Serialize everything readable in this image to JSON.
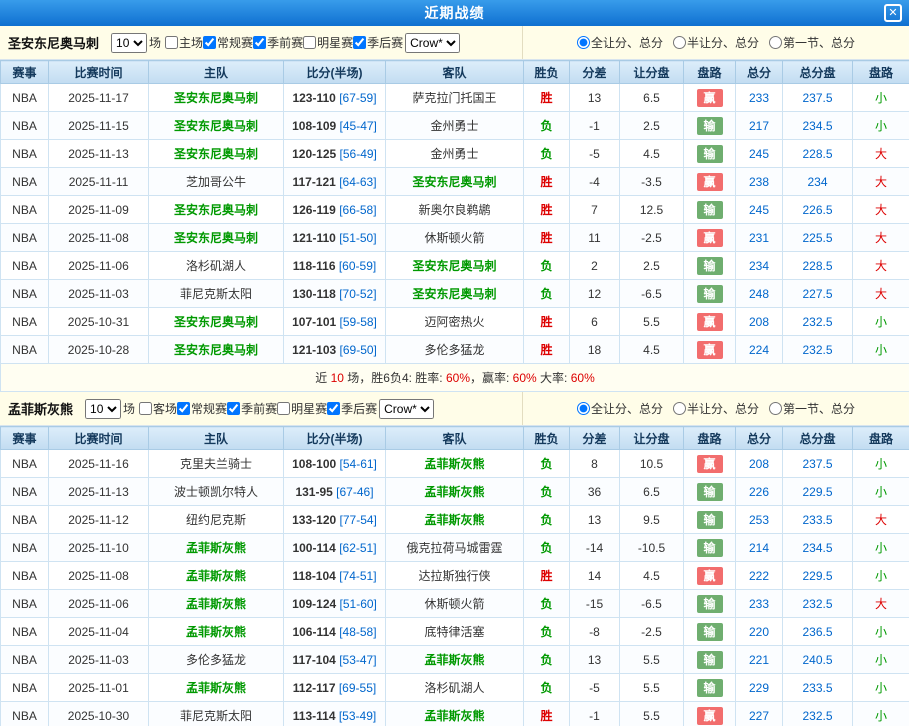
{
  "header": {
    "title": "近期战绩",
    "close_icon": "✕"
  },
  "colors": {
    "titlebar_blue": "#1e7fd6",
    "filter_bg": "#fffde8",
    "table_header_bg": "#cde3f4",
    "focus_team_green": "#009900",
    "win_red": "#dd0000",
    "lose_green": "#009900",
    "handicap_win_bg": "#f26d6d",
    "handicap_lose_bg": "#6fae6f",
    "number_blue": "#0066cc"
  },
  "filter_options": {
    "games_count": "10",
    "games_suffix": "场",
    "odds_company": "Crow*",
    "radios": [
      "全让分、总分",
      "半让分、总分",
      "第一节、总分"
    ]
  },
  "sections": [
    {
      "team": "圣安东尼奥马刺",
      "checkboxes": [
        {
          "key": "venue",
          "label": "主场",
          "checked": false
        },
        {
          "key": "regular-season",
          "label": "常规赛",
          "checked": true
        },
        {
          "key": "preseason",
          "label": "季前赛",
          "checked": true
        },
        {
          "key": "allstar",
          "label": "明星赛",
          "checked": false
        },
        {
          "key": "playoffs",
          "label": "季后赛",
          "checked": true
        }
      ],
      "columns": [
        "赛事",
        "比赛时间",
        "主队",
        "比分(半场)",
        "客队",
        "胜负",
        "分差",
        "让分盘",
        "盘路",
        "总分",
        "总分盘",
        "盘路"
      ],
      "rows": [
        {
          "league": "NBA",
          "date": "2025-11-17",
          "home": "圣安东尼奥马刺",
          "home_focus": true,
          "score": "123-110",
          "half": "[67-59]",
          "away": "萨克拉门托国王",
          "away_focus": false,
          "result": "胜",
          "diff": "13",
          "handicap": "6.5",
          "handicap_result": "赢",
          "total": "233",
          "total_line": "237.5",
          "total_result": "小"
        },
        {
          "league": "NBA",
          "date": "2025-11-15",
          "home": "圣安东尼奥马刺",
          "home_focus": true,
          "score": "108-109",
          "half": "[45-47]",
          "away": "金州勇士",
          "away_focus": false,
          "result": "负",
          "diff": "-1",
          "handicap": "2.5",
          "handicap_result": "输",
          "total": "217",
          "total_line": "234.5",
          "total_result": "小"
        },
        {
          "league": "NBA",
          "date": "2025-11-13",
          "home": "圣安东尼奥马刺",
          "home_focus": true,
          "score": "120-125",
          "half": "[56-49]",
          "away": "金州勇士",
          "away_focus": false,
          "result": "负",
          "diff": "-5",
          "handicap": "4.5",
          "handicap_result": "输",
          "total": "245",
          "total_line": "228.5",
          "total_result": "大"
        },
        {
          "league": "NBA",
          "date": "2025-11-11",
          "home": "芝加哥公牛",
          "home_focus": false,
          "score": "117-121",
          "half": "[64-63]",
          "away": "圣安东尼奥马刺",
          "away_focus": true,
          "result": "胜",
          "diff": "-4",
          "handicap": "-3.5",
          "handicap_result": "赢",
          "total": "238",
          "total_line": "234",
          "total_result": "大"
        },
        {
          "league": "NBA",
          "date": "2025-11-09",
          "home": "圣安东尼奥马刺",
          "home_focus": true,
          "score": "126-119",
          "half": "[66-58]",
          "away": "新奥尔良鹈鹕",
          "away_focus": false,
          "result": "胜",
          "diff": "7",
          "handicap": "12.5",
          "handicap_result": "输",
          "total": "245",
          "total_line": "226.5",
          "total_result": "大"
        },
        {
          "league": "NBA",
          "date": "2025-11-08",
          "home": "圣安东尼奥马刺",
          "home_focus": true,
          "score": "121-110",
          "half": "[51-50]",
          "away": "休斯顿火箭",
          "away_focus": false,
          "result": "胜",
          "diff": "11",
          "handicap": "-2.5",
          "handicap_result": "赢",
          "total": "231",
          "total_line": "225.5",
          "total_result": "大"
        },
        {
          "league": "NBA",
          "date": "2025-11-06",
          "home": "洛杉矶湖人",
          "home_focus": false,
          "score": "118-116",
          "half": "[60-59]",
          "away": "圣安东尼奥马刺",
          "away_focus": true,
          "result": "负",
          "diff": "2",
          "handicap": "2.5",
          "handicap_result": "输",
          "total": "234",
          "total_line": "228.5",
          "total_result": "大"
        },
        {
          "league": "NBA",
          "date": "2025-11-03",
          "home": "菲尼克斯太阳",
          "home_focus": false,
          "score": "130-118",
          "half": "[70-52]",
          "away": "圣安东尼奥马刺",
          "away_focus": true,
          "result": "负",
          "diff": "12",
          "handicap": "-6.5",
          "handicap_result": "输",
          "total": "248",
          "total_line": "227.5",
          "total_result": "大"
        },
        {
          "league": "NBA",
          "date": "2025-10-31",
          "home": "圣安东尼奥马刺",
          "home_focus": true,
          "score": "107-101",
          "half": "[59-58]",
          "away": "迈阿密热火",
          "away_focus": false,
          "result": "胜",
          "diff": "6",
          "handicap": "5.5",
          "handicap_result": "赢",
          "total": "208",
          "total_line": "232.5",
          "total_result": "小"
        },
        {
          "league": "NBA",
          "date": "2025-10-28",
          "home": "圣安东尼奥马刺",
          "home_focus": true,
          "score": "121-103",
          "half": "[69-50]",
          "away": "多伦多猛龙",
          "away_focus": false,
          "result": "胜",
          "diff": "18",
          "handicap": "4.5",
          "handicap_result": "赢",
          "total": "224",
          "total_line": "232.5",
          "total_result": "小"
        }
      ],
      "summary": [
        {
          "t": "近 ",
          "c": "#333333"
        },
        {
          "t": "10",
          "c": "#dd0000"
        },
        {
          "t": " 场，胜6负4: 胜率: ",
          "c": "#333333"
        },
        {
          "t": "60%",
          "c": "#dd0000"
        },
        {
          "t": "，赢率: ",
          "c": "#333333"
        },
        {
          "t": "60%",
          "c": "#dd0000"
        },
        {
          "t": " 大率: ",
          "c": "#333333"
        },
        {
          "t": "60%",
          "c": "#dd0000"
        }
      ]
    },
    {
      "team": "孟菲斯灰熊",
      "checkboxes": [
        {
          "key": "venue",
          "label": "客场",
          "checked": false
        },
        {
          "key": "regular-season",
          "label": "常规赛",
          "checked": true
        },
        {
          "key": "preseason",
          "label": "季前赛",
          "checked": true
        },
        {
          "key": "allstar",
          "label": "明星赛",
          "checked": false
        },
        {
          "key": "playoffs",
          "label": "季后赛",
          "checked": true
        }
      ],
      "columns": [
        "赛事",
        "比赛时间",
        "主队",
        "比分(半场)",
        "客队",
        "胜负",
        "分差",
        "让分盘",
        "盘路",
        "总分",
        "总分盘",
        "盘路"
      ],
      "rows": [
        {
          "league": "NBA",
          "date": "2025-11-16",
          "home": "克里夫兰骑士",
          "home_focus": false,
          "score": "108-100",
          "half": "[54-61]",
          "away": "孟菲斯灰熊",
          "away_focus": true,
          "result": "负",
          "diff": "8",
          "handicap": "10.5",
          "handicap_result": "赢",
          "total": "208",
          "total_line": "237.5",
          "total_result": "小"
        },
        {
          "league": "NBA",
          "date": "2025-11-13",
          "home": "波士顿凯尔特人",
          "home_focus": false,
          "score": "131-95",
          "half": "[67-46]",
          "away": "孟菲斯灰熊",
          "away_focus": true,
          "result": "负",
          "diff": "36",
          "handicap": "6.5",
          "handicap_result": "输",
          "total": "226",
          "total_line": "229.5",
          "total_result": "小"
        },
        {
          "league": "NBA",
          "date": "2025-11-12",
          "home": "纽约尼克斯",
          "home_focus": false,
          "score": "133-120",
          "half": "[77-54]",
          "away": "孟菲斯灰熊",
          "away_focus": true,
          "result": "负",
          "diff": "13",
          "handicap": "9.5",
          "handicap_result": "输",
          "total": "253",
          "total_line": "233.5",
          "total_result": "大"
        },
        {
          "league": "NBA",
          "date": "2025-11-10",
          "home": "孟菲斯灰熊",
          "home_focus": true,
          "score": "100-114",
          "half": "[62-51]",
          "away": "俄克拉荷马城雷霆",
          "away_focus": false,
          "result": "负",
          "diff": "-14",
          "handicap": "-10.5",
          "handicap_result": "输",
          "total": "214",
          "total_line": "234.5",
          "total_result": "小"
        },
        {
          "league": "NBA",
          "date": "2025-11-08",
          "home": "孟菲斯灰熊",
          "home_focus": true,
          "score": "118-104",
          "half": "[74-51]",
          "away": "达拉斯独行侠",
          "away_focus": false,
          "result": "胜",
          "diff": "14",
          "handicap": "4.5",
          "handicap_result": "赢",
          "total": "222",
          "total_line": "229.5",
          "total_result": "小"
        },
        {
          "league": "NBA",
          "date": "2025-11-06",
          "home": "孟菲斯灰熊",
          "home_focus": true,
          "score": "109-124",
          "half": "[51-60]",
          "away": "休斯顿火箭",
          "away_focus": false,
          "result": "负",
          "diff": "-15",
          "handicap": "-6.5",
          "handicap_result": "输",
          "total": "233",
          "total_line": "232.5",
          "total_result": "大"
        },
        {
          "league": "NBA",
          "date": "2025-11-04",
          "home": "孟菲斯灰熊",
          "home_focus": true,
          "score": "106-114",
          "half": "[48-58]",
          "away": "底特律活塞",
          "away_focus": false,
          "result": "负",
          "diff": "-8",
          "handicap": "-2.5",
          "handicap_result": "输",
          "total": "220",
          "total_line": "236.5",
          "total_result": "小"
        },
        {
          "league": "NBA",
          "date": "2025-11-03",
          "home": "多伦多猛龙",
          "home_focus": false,
          "score": "117-104",
          "half": "[53-47]",
          "away": "孟菲斯灰熊",
          "away_focus": true,
          "result": "负",
          "diff": "13",
          "handicap": "5.5",
          "handicap_result": "输",
          "total": "221",
          "total_line": "240.5",
          "total_result": "小"
        },
        {
          "league": "NBA",
          "date": "2025-11-01",
          "home": "孟菲斯灰熊",
          "home_focus": true,
          "score": "112-117",
          "half": "[69-55]",
          "away": "洛杉矶湖人",
          "away_focus": false,
          "result": "负",
          "diff": "-5",
          "handicap": "5.5",
          "handicap_result": "输",
          "total": "229",
          "total_line": "233.5",
          "total_result": "小"
        },
        {
          "league": "NBA",
          "date": "2025-10-30",
          "home": "菲尼克斯太阳",
          "home_focus": false,
          "score": "113-114",
          "half": "[53-49]",
          "away": "孟菲斯灰熊",
          "away_focus": true,
          "result": "胜",
          "diff": "-1",
          "handicap": "5.5",
          "handicap_result": "赢",
          "total": "227",
          "total_line": "232.5",
          "total_result": "小"
        }
      ],
      "summary": null
    }
  ]
}
